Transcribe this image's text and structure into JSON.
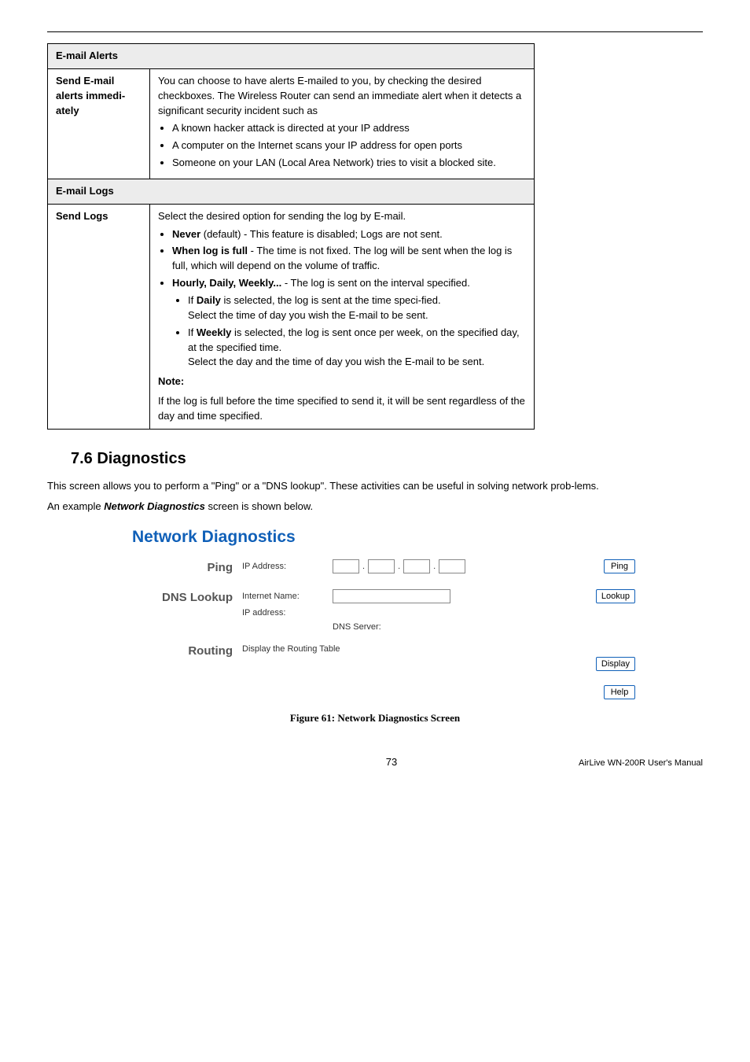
{
  "table": {
    "email_alerts_header": "E-mail Alerts",
    "send_alerts_label": "Send E-mail alerts immedi-ately",
    "alerts_intro": "You can choose to have alerts E-mailed to you, by checking the desired checkboxes. The Wireless Router can send an immediate alert when it detects a significant security incident such as",
    "alerts_bullets": [
      "A known hacker attack is directed at your IP address",
      "A computer on the Internet scans your IP address for open ports",
      "Someone on your LAN (Local Area Network) tries to visit a blocked site."
    ],
    "email_logs_header": "E-mail Logs",
    "send_logs_label": "Send Logs",
    "logs_intro": "Select the desired option for sending the log by E-mail.",
    "logs_never_bold": "Never",
    "logs_never_rest": " (default) - This feature is disabled; Logs are not sent.",
    "logs_full_bold": "When log is full",
    "logs_full_rest": " - The time is not fixed. The log will be sent when the log is full, which will depend on the volume of traffic.",
    "logs_hdw_bold": "Hourly, Daily, Weekly...",
    "logs_hdw_rest": "  - The log is sent on the interval specified.",
    "logs_daily_pre": "If ",
    "logs_daily_bold": "Daily",
    "logs_daily_rest": " is selected, the log is sent at the time speci-fied.",
    "logs_daily_line2": "Select the time of day you wish the E-mail to be sent.",
    "logs_weekly_pre": "If ",
    "logs_weekly_bold": "Weekly",
    "logs_weekly_rest": " is selected, the log is sent once per week, on the specified day, at the specified time.",
    "logs_weekly_line2": "Select the day and the time of day you wish the E-mail to be sent.",
    "note_label": "Note:",
    "note_text": "If the log is full before the time specified to send it, it will be sent regardless of the day and time specified."
  },
  "section": {
    "number_title": "7.6  Diagnostics",
    "p1": "This screen allows you to perform a \"Ping\" or a \"DNS lookup\". These activities can be useful in solving network prob-lems.",
    "p2_pre": "An example ",
    "p2_bold": "Network Diagnostics",
    "p2_post": " screen is shown below."
  },
  "diag": {
    "title": "Network Diagnostics",
    "ping_label": "Ping",
    "ip_address_label": "IP Address:",
    "ping_btn": "Ping",
    "dns_label": "DNS Lookup",
    "internet_name_label": "Internet Name:",
    "ip_addr2_label": "IP address:",
    "dns_server_label": "DNS Server:",
    "lookup_btn": "Lookup",
    "routing_label": "Routing",
    "routing_text": "Display the Routing Table",
    "display_btn": "Display",
    "help_btn": "Help"
  },
  "caption": "Figure 61: Network Diagnostics Screen",
  "footer": {
    "page_num": "73",
    "manual": "AirLive WN-200R User's Manual"
  }
}
